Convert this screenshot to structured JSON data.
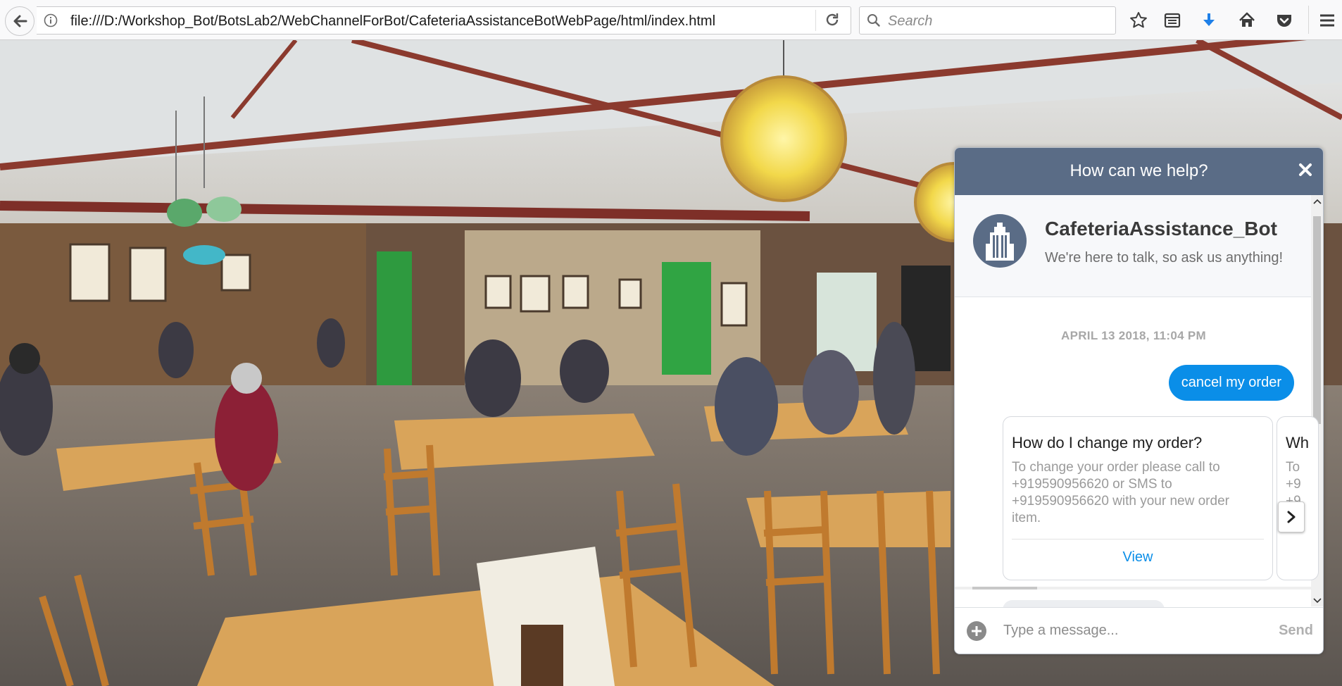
{
  "browser": {
    "url": "file:///D:/Workshop_Bot/BotsLab2/WebChannelForBot/CafeteriaAssistanceBotWebPage/html/index.html",
    "search_placeholder": "Search",
    "icons": [
      "back-arrow-icon",
      "info-icon",
      "reload-icon",
      "search-icon",
      "bookmark-star-icon",
      "reading-list-icon",
      "download-icon",
      "home-icon",
      "pocket-icon",
      "menu-icon"
    ]
  },
  "chat": {
    "header_title": "How can we help?",
    "bot_name": "CafeteriaAssistance_Bot",
    "bot_tagline": "We're here to talk, so ask us anything!",
    "timestamp": "APRIL 13 2018, 11:04 PM",
    "user_message": "cancel my order",
    "cards": [
      {
        "title": "How do I change my order?",
        "body": "To change your order please call to +919590956620 or SMS to +919590956620 with your new order item.",
        "button": "View"
      },
      {
        "title": "Wh",
        "body_lines": [
          "To",
          "+9",
          "+9"
        ]
      }
    ],
    "input_placeholder": "Type a message...",
    "send_label": "Send",
    "colors": {
      "header": "#5a6c86",
      "user_bubble": "#0a8ee8",
      "link": "#0a8ee8"
    }
  }
}
